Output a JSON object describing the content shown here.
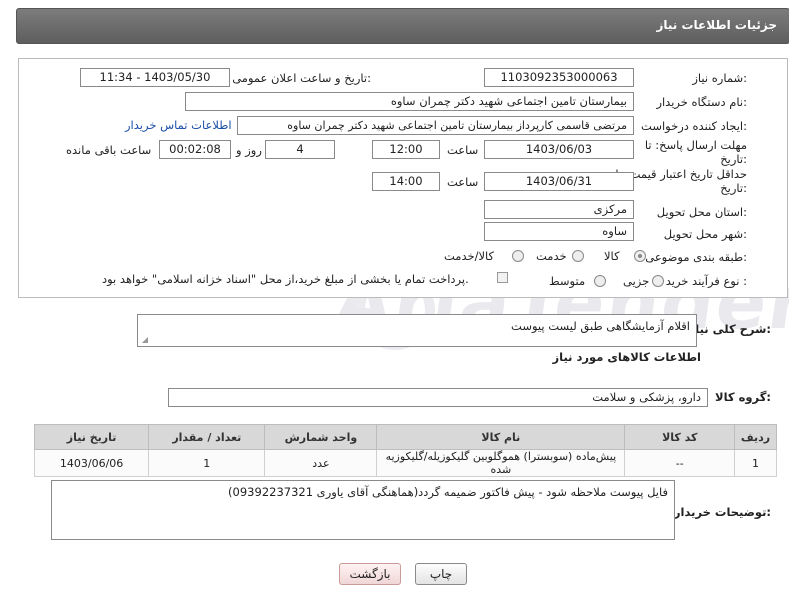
{
  "header": {
    "title": "جزئیات اطلاعات نیاز"
  },
  "watermark": "AriaTender.neT",
  "form": {
    "need_number_label": "شماره نیاز:",
    "need_number": "1103092353000063",
    "announce_label": "تاریخ و ساعت اعلان عمومی:",
    "announce_value": "1403/05/30 - 11:34",
    "buyer_org_label": "نام دستگاه خریدار:",
    "buyer_org": "بیمارستان تامین اجتماعی شهید دکتر چمران ساوه",
    "requester_label": "ایجاد کننده درخواست:",
    "requester": "مرتضی قاسمی کارپرداز بیمارستان تامین اجتماعی شهید دکتر چمران ساوه",
    "contact_link": "اطلاعات تماس خریدار",
    "reply_deadline_label_1": "مهلت ارسال پاسخ: تا",
    "reply_deadline_label_2": "تاریخ:",
    "reply_date": "1403/06/03",
    "time_label": "ساعت",
    "reply_time": "12:00",
    "days_value": "4",
    "days_label": "روز و",
    "remaining_time": "00:02:08",
    "remaining_label": "ساعت باقی مانده",
    "price_deadline_label_1": "حداقل تاریخ اعتبار قیمت: تا",
    "price_deadline_label_2": "تاریخ:",
    "price_date": "1403/06/31",
    "price_time": "14:00",
    "province_label": "استان محل تحویل:",
    "province": "مرکزی",
    "city_label": "شهر محل تحویل:",
    "city": "ساوه",
    "category_label": "طبقه بندی موضوعی:",
    "category_options": [
      "کالا",
      "خدمت",
      "کالا/خدمت"
    ],
    "category_selected": "کالا",
    "process_label": "نوع فرآیند خرید :",
    "process_options": [
      "جزیی",
      "متوسط"
    ],
    "payment_note": "پرداخت تمام یا بخشی از مبلغ خرید،از محل \"اسناد خزانه اسلامی\" خواهد بود."
  },
  "description": {
    "label": "شرح کلی نیاز:",
    "value": "اقلام آزمایشگاهی طبق لیست پیوست"
  },
  "goods": {
    "section_title": "اطلاعات کالاهای مورد نیاز",
    "group_label": "گروه کالا:",
    "group_value": "دارو، پزشکی و سلامت",
    "columns": [
      "ردیف",
      "کد کالا",
      "نام کالا",
      "واحد شمارش",
      "تعداد / مقدار",
      "تاریخ نیاز"
    ],
    "rows": [
      [
        "1",
        "--",
        "پیش‌ماده (سوبسترا) هموگلوبین گلیکوزیله/گلیکوزیه شده",
        "عدد",
        "1",
        "1403/06/06"
      ]
    ]
  },
  "buyer_notes": {
    "label": "توضیحات خریدار:",
    "value": "فایل پیوست ملاحظه شود - پیش فاکتور ضمیمه گردد(هماهنگی آقای یاوری 09392237321)"
  },
  "buttons": {
    "print": "چاپ",
    "back": "بازگشت"
  }
}
